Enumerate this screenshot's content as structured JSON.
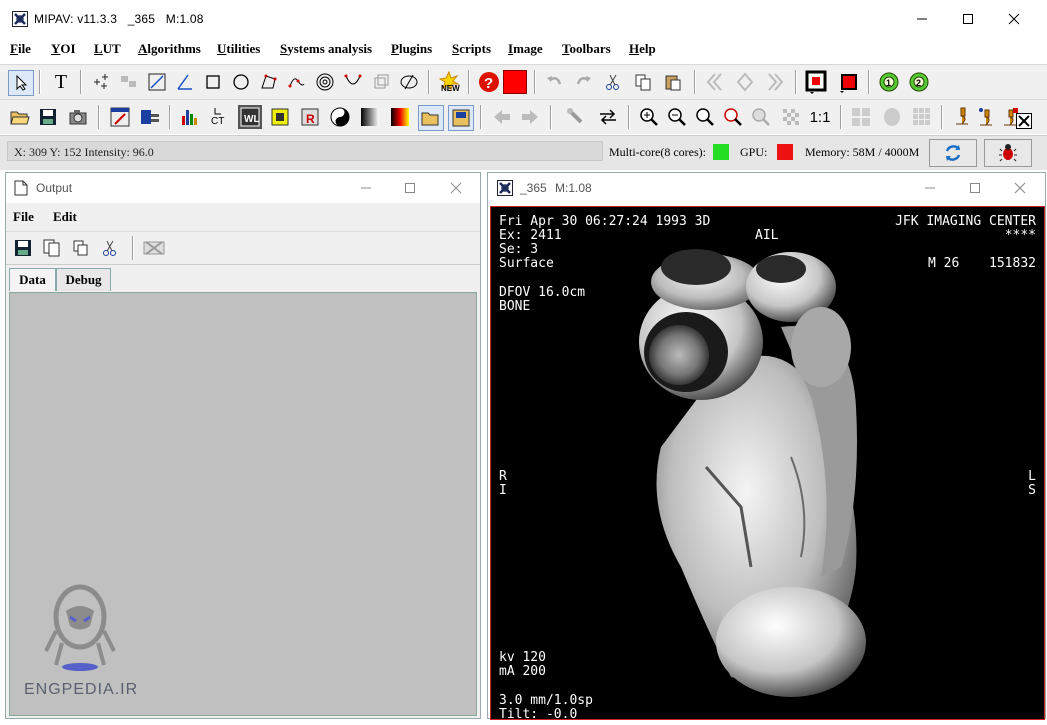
{
  "main_window": {
    "app": "MIPAV:",
    "version": "v11.3.3",
    "image": "_365",
    "zoom": "M:1.08"
  },
  "menu": [
    "File",
    "YOI",
    "LUT",
    "Algorithms",
    "Utilities",
    "Systems analysis",
    "Plugins",
    "Scripts",
    "Image",
    "Toolbars",
    "Help"
  ],
  "status": {
    "coords": "X: 309 Y: 152  Intensity:  96.0",
    "multicore_label": "Multi-core(8 cores):",
    "gpu_label": "GPU:",
    "memory": "Memory: 58M / 4000M",
    "multicore_color": "#22dd22",
    "gpu_color": "#ee1111"
  },
  "output_window": {
    "title": "Output",
    "menu": [
      "File",
      "Edit"
    ],
    "tabs": [
      "Data",
      "Debug"
    ],
    "active_tab": "Data"
  },
  "image_window": {
    "title": "_365",
    "zoom": "M:1.08",
    "overlay": {
      "date": "Fri Apr 30 06:27:24 1993 3D",
      "center": "JFK IMAGING CENTER",
      "ex": "Ex: 2411",
      "ail": "AIL",
      "stars": "****",
      "se": "Se: 3",
      "surface": "Surface",
      "m26": "M 26",
      "id": "151832",
      "dfov": "DFOV 16.0cm",
      "bone": "BONE",
      "r": "R",
      "i": "I",
      "l": "L",
      "s": "S",
      "kv": "kv 120",
      "ma": "mA 200",
      "mm": "3.0 mm/1.0sp",
      "tilt": "Tilt: -0.0"
    }
  },
  "watermark": "ENGPEDIA.IR",
  "colors": {
    "red_swatch": "#ff0000",
    "accent": "#000000"
  }
}
